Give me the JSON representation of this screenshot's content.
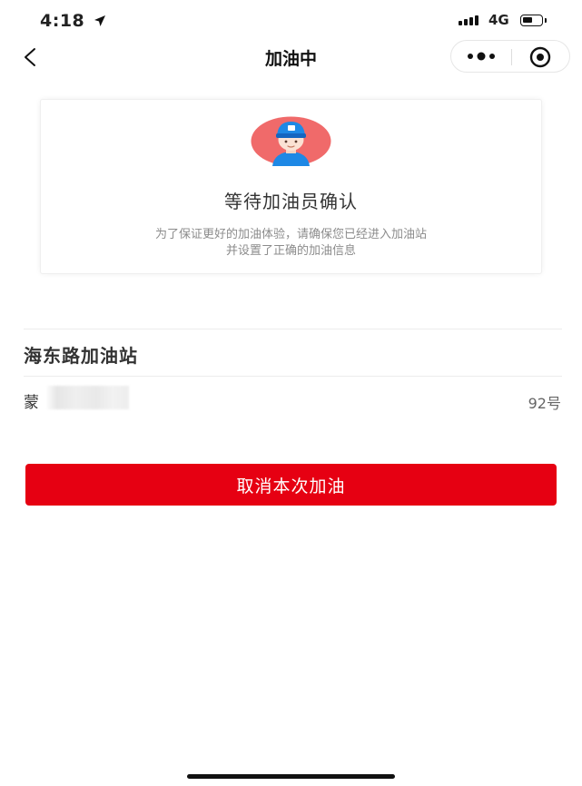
{
  "status_bar": {
    "time": "4:18",
    "network": "4G",
    "location_icon": "location-arrow-icon",
    "signal_icon": "signal-bars-icon",
    "battery_icon": "battery-icon"
  },
  "nav": {
    "title": "加油中",
    "back_icon": "chevron-left-icon",
    "more_icon": "more-dots-icon",
    "close_icon": "target-circle-icon"
  },
  "status_card": {
    "avatar_icon": "attendant-avatar-icon",
    "title": "等待加油员确认",
    "description_line1": "为了保证更好的加油体验，请确保您已经进入加油站",
    "description_line2": "并设置了正确的加油信息"
  },
  "order": {
    "station_name": "海东路加油站",
    "plate_prefix": "蒙",
    "fuel_type": "92号"
  },
  "actions": {
    "cancel_label": "取消本次加油"
  },
  "colors": {
    "primary_red": "#e60012",
    "avatar_bg": "#f06a6a",
    "cap_blue": "#1e88e5"
  }
}
